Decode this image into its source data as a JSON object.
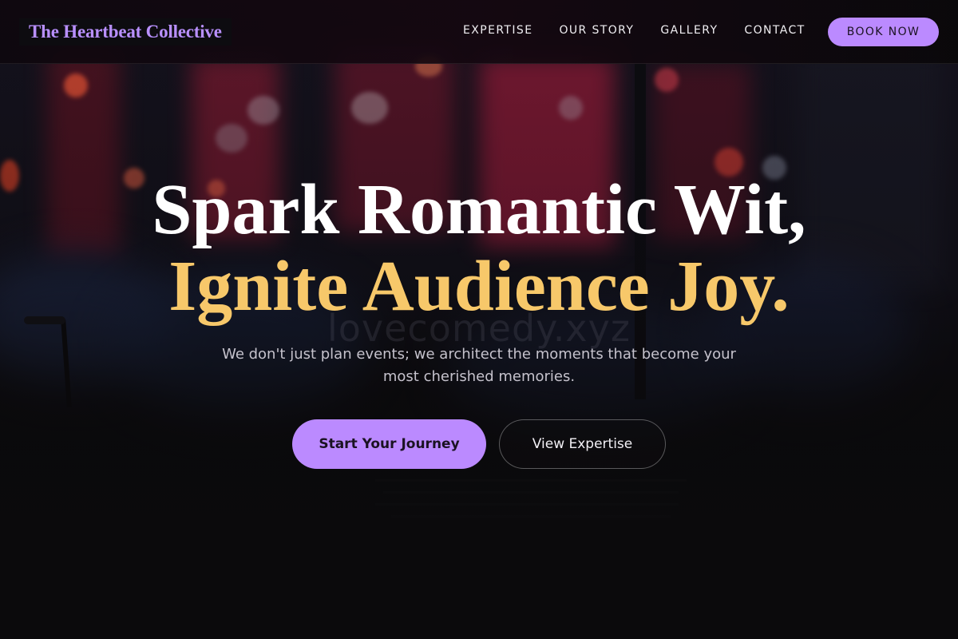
{
  "brand": {
    "name": "The Heartbeat Collective"
  },
  "nav": {
    "items": [
      {
        "label": "EXPERTISE"
      },
      {
        "label": "OUR STORY"
      },
      {
        "label": "GALLERY"
      },
      {
        "label": "CONTACT"
      }
    ],
    "cta_label": "BOOK NOW"
  },
  "hero": {
    "headline_line1": "Spark Romantic Wit,",
    "headline_line2": "Ignite Audience Joy.",
    "watermark": "lovecomedy.xyz",
    "subtitle": "We don't just plan events; we architect the moments that become your most cherished memories.",
    "primary_button": "Start Your Journey",
    "secondary_button": "View Expertise"
  },
  "colors": {
    "accent": "#bb8aff",
    "highlight": "#f7c86a",
    "background": "#0c0b0d"
  }
}
